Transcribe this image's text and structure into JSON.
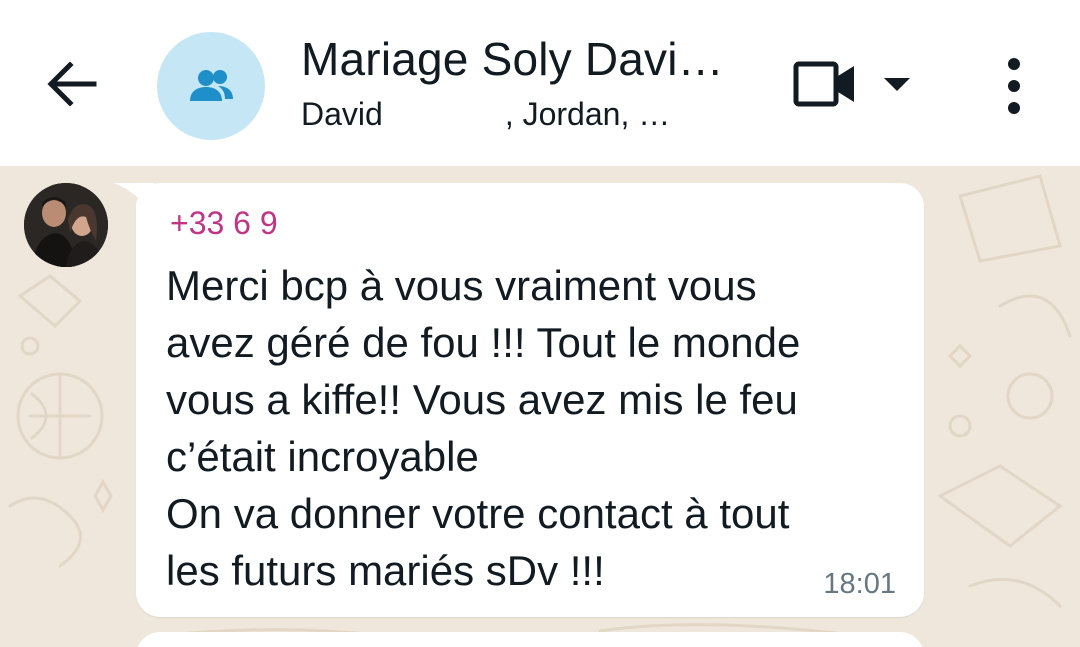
{
  "header": {
    "title": "Mariage Soly Davi…",
    "subtitle_prefix": "David",
    "subtitle_suffix": ", Jordan, …",
    "icons": [
      "back-arrow-icon",
      "group-icon",
      "video-call-icon",
      "dropdown-caret-icon",
      "more-vert-icon"
    ]
  },
  "message": {
    "sender": "+33 6 9",
    "text": "Merci bcp à vous vraiment vous\navez géré de fou !!! Tout le monde\nvous a kiffe!! Vous avez mis le feu\nc’était incroyable\nOn va donner votre contact à tout\nles futurs mariés sDv !!!",
    "time": "18:01"
  },
  "colors": {
    "header_bg": "#ffffff",
    "chat_bg": "#efe7dc",
    "avatar_bg": "#c5e6f5",
    "avatar_icon": "#1f8fc9",
    "sender_name": "#c13584",
    "time_text": "#667781"
  }
}
